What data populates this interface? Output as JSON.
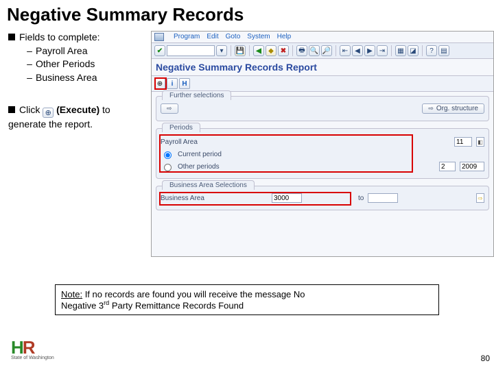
{
  "title": "Negative Summary Records",
  "left": {
    "fields_heading": "Fields to complete:",
    "items": [
      "Payroll Area",
      "Other Periods",
      "Business Area"
    ],
    "click_prefix": "Click",
    "execute_label": "(Execute)",
    "click_suffix": " to",
    "click_line2": "generate the report."
  },
  "sap": {
    "menu": [
      "Program",
      "Edit",
      "Goto",
      "System",
      "Help"
    ],
    "report_title": "Negative Summary Records Report",
    "apptool_icons": [
      "clock-icon",
      "blue-i-icon",
      "blue-h-icon"
    ],
    "section1": {
      "tab": "Further selections",
      "btn": "Org. structure"
    },
    "periods": {
      "tab": "Periods",
      "payroll_area_label": "Payroll Area",
      "payroll_area_value": "11",
      "current_label": "Current period",
      "other_label": "Other periods",
      "other_val1": "2",
      "other_val2": "2009"
    },
    "business": {
      "tab": "Business Area Selections",
      "label": "Business Area",
      "value": "3000",
      "to_label": "to"
    }
  },
  "note": {
    "prefix": "Note:",
    "text_a": " If no records are found you will receive the message No",
    "text_b": "Negative 3",
    "text_c": " Party Remittance Records Found",
    "sup": "rd"
  },
  "footer": {
    "logo_sub": "State of Washington",
    "page": "80"
  }
}
